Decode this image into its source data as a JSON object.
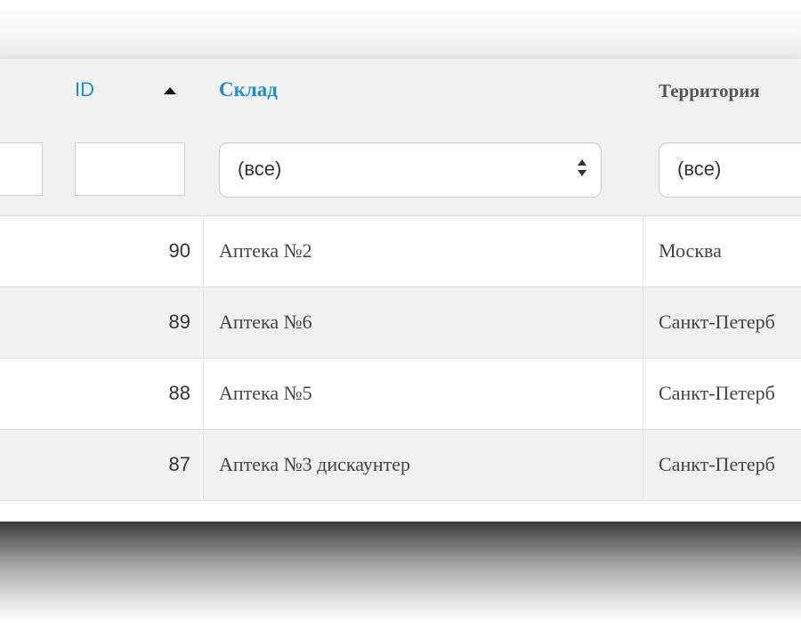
{
  "table": {
    "headers": {
      "id": "ID",
      "sklad": "Склад",
      "territory": "Территория"
    },
    "filters": {
      "sklad_select": "(все)",
      "territory_select": "(все)"
    },
    "rows": [
      {
        "id": "90",
        "sklad": "Аптека №2",
        "territory": "Москва"
      },
      {
        "id": "89",
        "sklad": "Аптека №6",
        "territory": "Санкт-Петерб"
      },
      {
        "id": "88",
        "sklad": "Аптека №5",
        "territory": "Санкт-Петерб"
      },
      {
        "id": "87",
        "sklad": "Аптека №3 дискаунтер",
        "territory": "Санкт-Петерб"
      }
    ]
  },
  "colors": {
    "link_blue": "#1a8fd2",
    "header_bg": "#f0f0f0",
    "row_alt_bg": "#f1f1f1"
  }
}
